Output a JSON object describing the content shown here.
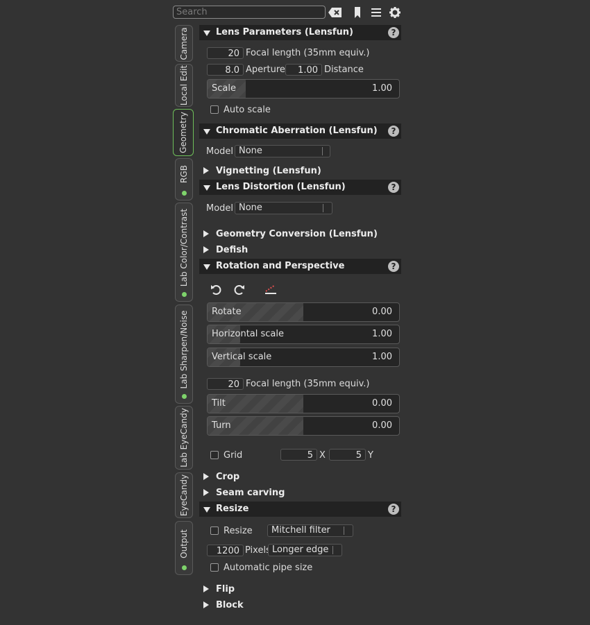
{
  "search": {
    "placeholder": "Search"
  },
  "tabs": [
    {
      "label": "Camera",
      "dot": false
    },
    {
      "label": "Local Edit",
      "dot": false
    },
    {
      "label": "Geometry",
      "dot": false
    },
    {
      "label": "RGB",
      "dot": true
    },
    {
      "label": "Lab Color/Contrast",
      "dot": true
    },
    {
      "label": "Lab Sharpen/Noise",
      "dot": true
    },
    {
      "label": "Lab EyeCandy",
      "dot": false
    },
    {
      "label": "EyeCandy",
      "dot": false
    },
    {
      "label": "Output",
      "dot": true
    }
  ],
  "active_tab": "Geometry",
  "lens": {
    "title": "Lens Parameters (Lensfun)",
    "focal_value": "20",
    "focal_label": "Focal length (35mm equiv.)",
    "aperture_value": "8.0",
    "aperture_label": "Aperture",
    "distance_value": "1.00",
    "distance_label": "Distance",
    "scale_label": "Scale",
    "scale_value": "1.00",
    "auto_scale_label": "Auto scale"
  },
  "ca": {
    "title": "Chromatic Aberration (Lensfun)",
    "model_label": "Model",
    "model_value": "None"
  },
  "vignetting": {
    "title": "Vignetting (Lensfun)"
  },
  "distortion": {
    "title": "Lens Distortion (Lensfun)",
    "model_label": "Model",
    "model_value": "None"
  },
  "geoconv": {
    "title": "Geometry Conversion (Lensfun)"
  },
  "defish": {
    "title": "Defish"
  },
  "rotation": {
    "title": "Rotation and Perspective",
    "rotate_label": "Rotate",
    "rotate_value": "0.00",
    "rotate_fraction": 0.5,
    "hscale_label": "Horizontal scale",
    "hscale_value": "1.00",
    "hscale_fraction": 0.17,
    "vscale_label": "Vertical scale",
    "vscale_value": "1.00",
    "vscale_fraction": 0.17,
    "focal_value": "20",
    "focal_label": "Focal length (35mm equiv.)",
    "tilt_label": "Tilt",
    "tilt_value": "0.00",
    "tilt_fraction": 0.5,
    "turn_label": "Turn",
    "turn_value": "0.00",
    "turn_fraction": 0.5,
    "grid_label": "Grid",
    "grid_x": "5",
    "grid_x_label": "X",
    "grid_y": "5",
    "grid_y_label": "Y"
  },
  "crop": {
    "title": "Crop"
  },
  "seam": {
    "title": "Seam carving"
  },
  "resize": {
    "title": "Resize",
    "resize_label": "Resize",
    "filter_value": "Mitchell filter",
    "pixels_value": "1200",
    "pixels_label": "Pixels",
    "edge_value": "Longer edge",
    "auto_pipe_label": "Automatic pipe size"
  },
  "flip": {
    "title": "Flip"
  },
  "block": {
    "title": "Block"
  },
  "help_glyph": "?",
  "scale_fraction": 0.2
}
